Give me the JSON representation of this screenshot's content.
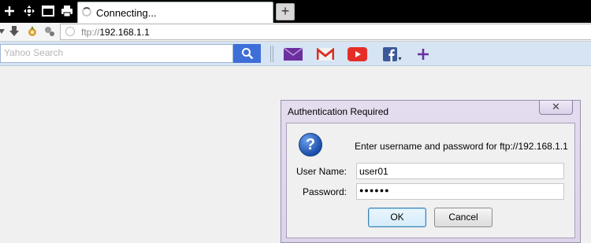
{
  "tab": {
    "title": "Connecting...",
    "newtab_symbol": "+"
  },
  "address": {
    "scheme": "ftp://",
    "host": "192.168.1.1"
  },
  "toolbar": {
    "search_placeholder": "Yahoo Search",
    "tools": [
      "mail-icon",
      "gmail-icon",
      "youtube-icon",
      "facebook-icon",
      "add-icon"
    ],
    "facebook_dropdown": "▾",
    "add_symbol": "+"
  },
  "dialog": {
    "title": "Authentication Required",
    "close_symbol": "✕",
    "icon_symbol": "?",
    "prompt": "Enter username and password for ftp://192.168.1.1",
    "username_label": "User Name:",
    "username_value": "user01",
    "password_label": "Password:",
    "password_mask": "●●●●●●",
    "ok_label": "OK",
    "cancel_label": "Cancel"
  },
  "colors": {
    "toolbar_bg": "#d6e4f4",
    "search_button": "#3e6fd8",
    "dialog_frame": "#ddd4ea"
  }
}
